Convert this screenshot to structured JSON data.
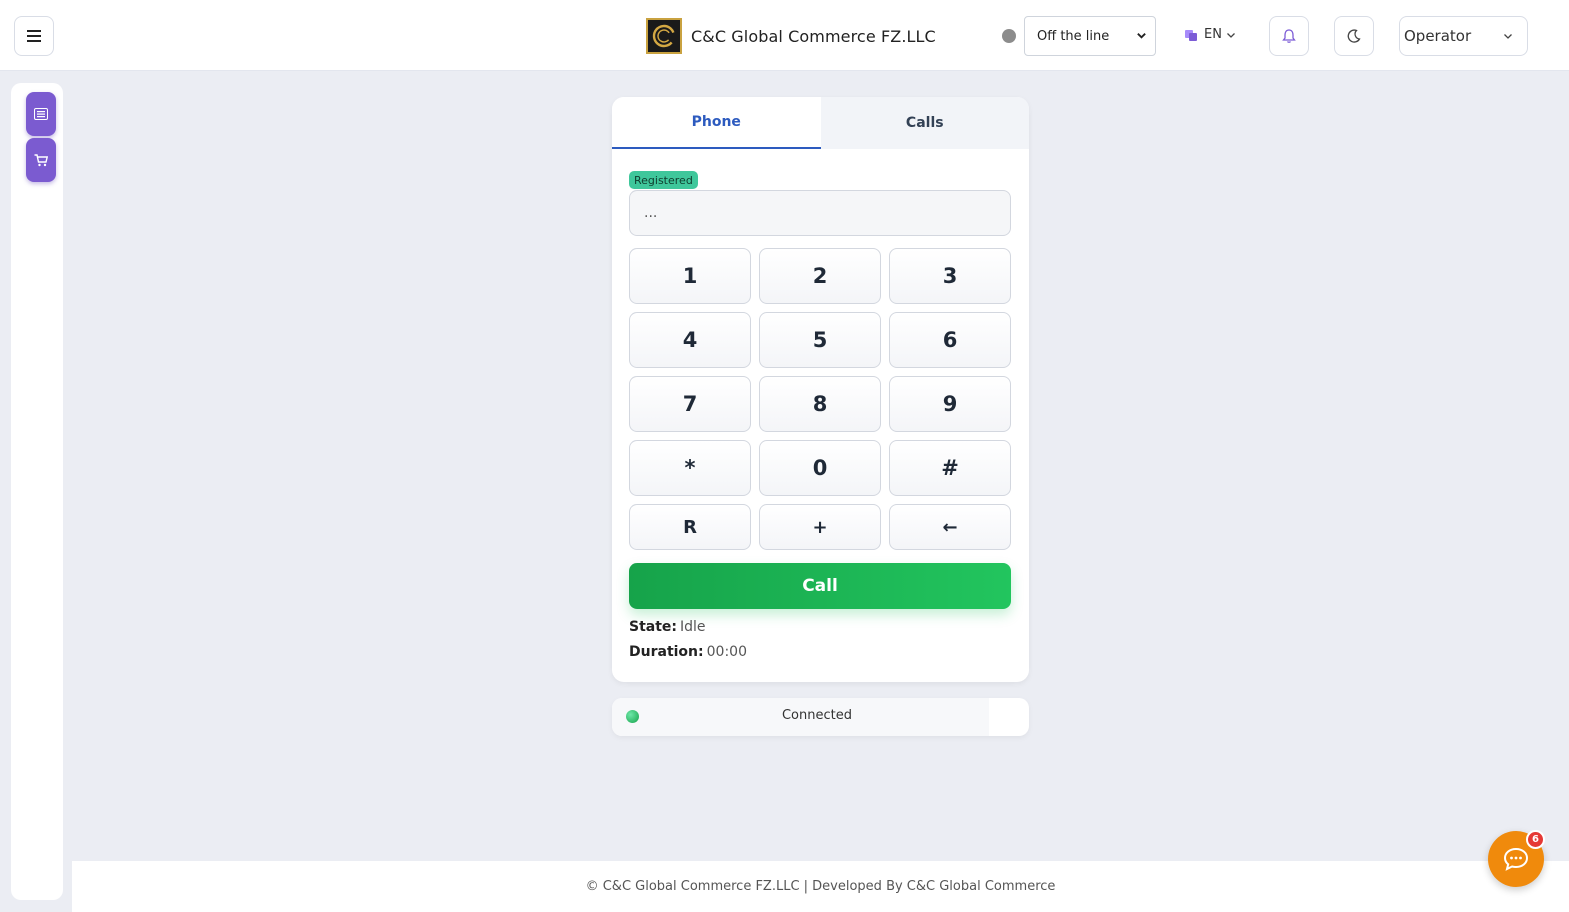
{
  "header": {
    "company_name": "C&C Global Commerce FZ.LLC",
    "status_select": "Off the line",
    "language": "EN",
    "user_label": "Operator"
  },
  "phone": {
    "tabs": [
      {
        "label": "Phone",
        "active": true
      },
      {
        "label": "Calls",
        "active": false
      }
    ],
    "registration_badge": "Registered",
    "dial_input_value": "...",
    "keys": [
      [
        "1",
        "2",
        "3"
      ],
      [
        "4",
        "5",
        "6"
      ],
      [
        "7",
        "8",
        "9"
      ],
      [
        "*",
        "0",
        "#"
      ],
      [
        "R",
        "+",
        "←"
      ]
    ],
    "call_button": "Call",
    "state_label": "State:",
    "state_value": "Idle",
    "duration_label": "Duration:",
    "duration_value": "00:00"
  },
  "connection": {
    "status": "Connected"
  },
  "footer": {
    "text": "© C&C Global Commerce FZ.LLC | Developed By C&C Global Commerce"
  },
  "chat": {
    "badge_count": "6"
  },
  "colors": {
    "accent_blue": "#2d5bbf",
    "call_green": "#16a34a",
    "registered_badge": "#3fc79b",
    "sidebar_purple": "#7b5bd0",
    "chat_orange": "#f08a0c",
    "status_offline": "#8c8c8c"
  },
  "icons": {
    "menu": "hamburger-icon",
    "bell": "bell-icon",
    "theme": "moon-icon",
    "sidebar_1": "list-icon",
    "sidebar_2": "cart-icon",
    "chat": "chat-bubble-icon",
    "language": "translate-icon"
  }
}
